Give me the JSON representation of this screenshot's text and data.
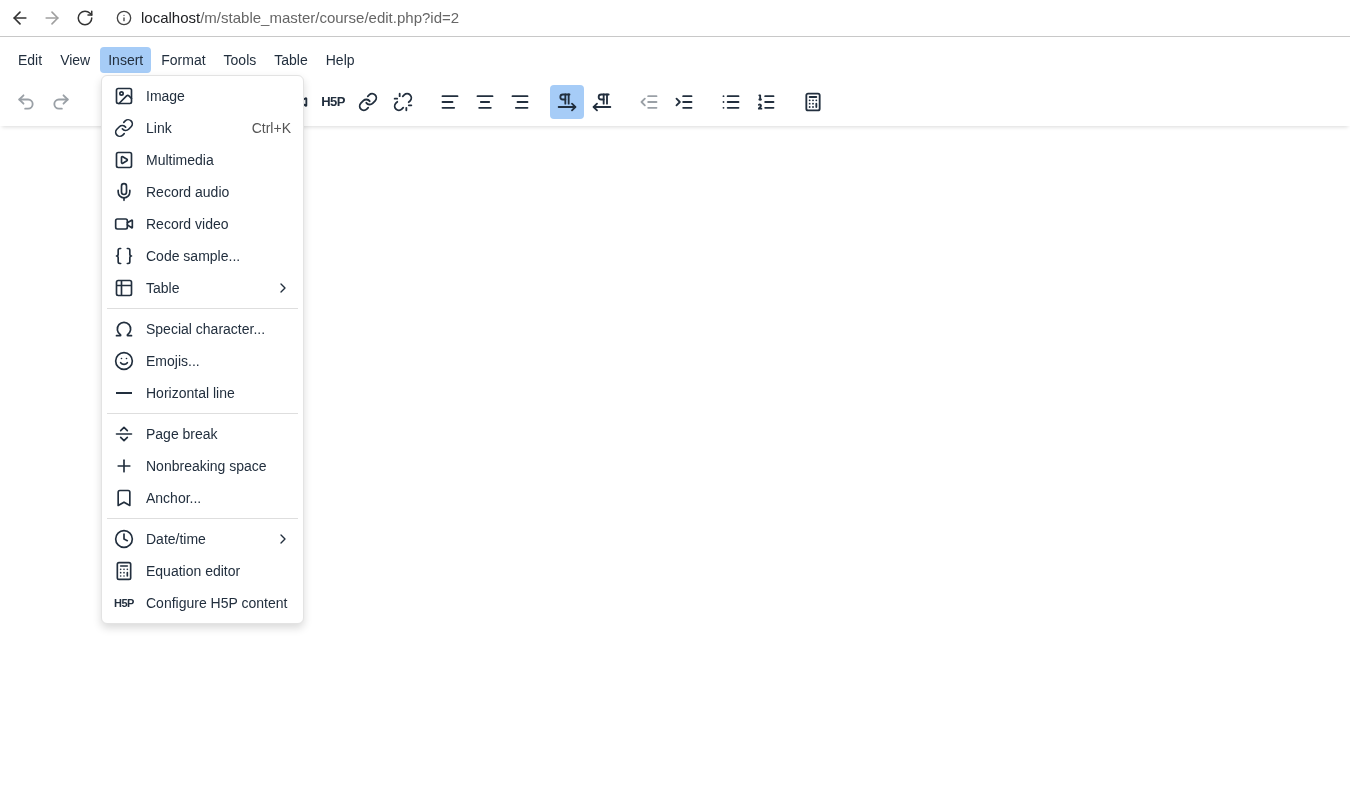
{
  "browser": {
    "back_disabled": false,
    "forward_disabled": true,
    "url_host": "localhost",
    "url_path": "/m/stable_master/course/edit.php?id=2"
  },
  "menubar": [
    {
      "label": "Edit",
      "selected": false
    },
    {
      "label": "View",
      "selected": false
    },
    {
      "label": "Insert",
      "selected": true
    },
    {
      "label": "Format",
      "selected": false
    },
    {
      "label": "Tools",
      "selected": false
    },
    {
      "label": "Table",
      "selected": false
    },
    {
      "label": "Help",
      "selected": false
    }
  ],
  "toolbar": [
    [
      {
        "kind": "undo",
        "disabled": true,
        "selected": false
      },
      {
        "kind": "redo",
        "disabled": true,
        "selected": false
      }
    ],
    [
      {
        "kind": "video",
        "disabled": false,
        "selected": false
      },
      {
        "kind": "h5p",
        "text": "H5P",
        "disabled": false,
        "selected": false
      },
      {
        "kind": "link",
        "disabled": false,
        "selected": false
      },
      {
        "kind": "unlink",
        "disabled": false,
        "selected": false
      }
    ],
    [
      {
        "kind": "align-left",
        "disabled": false,
        "selected": false
      },
      {
        "kind": "align-center",
        "disabled": false,
        "selected": false
      },
      {
        "kind": "align-right",
        "disabled": false,
        "selected": false
      }
    ],
    [
      {
        "kind": "ltr",
        "disabled": false,
        "selected": true
      },
      {
        "kind": "rtl",
        "disabled": false,
        "selected": false
      }
    ],
    [
      {
        "kind": "outdent",
        "disabled": true,
        "selected": false
      },
      {
        "kind": "indent",
        "disabled": false,
        "selected": false
      }
    ],
    [
      {
        "kind": "bullets",
        "disabled": false,
        "selected": false
      },
      {
        "kind": "numbers",
        "disabled": false,
        "selected": false
      }
    ],
    [
      {
        "kind": "calculator",
        "disabled": false,
        "selected": false
      }
    ]
  ],
  "insert_menu": [
    [
      {
        "kind": "image",
        "label": "Image",
        "submenu": false
      },
      {
        "kind": "link",
        "label": "Link",
        "shortcut": "Ctrl+K",
        "submenu": false
      },
      {
        "kind": "multimedia",
        "label": "Multimedia",
        "submenu": false
      },
      {
        "kind": "mic",
        "label": "Record audio",
        "submenu": false
      },
      {
        "kind": "video",
        "label": "Record video",
        "submenu": false
      },
      {
        "kind": "code",
        "label": "Code sample...",
        "submenu": false
      },
      {
        "kind": "table",
        "label": "Table",
        "submenu": true
      }
    ],
    [
      {
        "kind": "omega",
        "label": "Special character...",
        "submenu": false
      },
      {
        "kind": "emoji",
        "label": "Emojis...",
        "submenu": false
      },
      {
        "kind": "hr",
        "label": "Horizontal line",
        "submenu": false
      }
    ],
    [
      {
        "kind": "pagebreak",
        "label": "Page break",
        "submenu": false
      },
      {
        "kind": "nbsp",
        "label": "Nonbreaking space",
        "submenu": false
      },
      {
        "kind": "bookmark",
        "label": "Anchor...",
        "submenu": false
      }
    ],
    [
      {
        "kind": "clock",
        "label": "Date/time",
        "submenu": true
      },
      {
        "kind": "calculator",
        "label": "Equation editor",
        "submenu": false
      },
      {
        "kind": "h5p",
        "icon_text": "H5P",
        "label": "Configure H5P content",
        "submenu": false
      }
    ]
  ]
}
